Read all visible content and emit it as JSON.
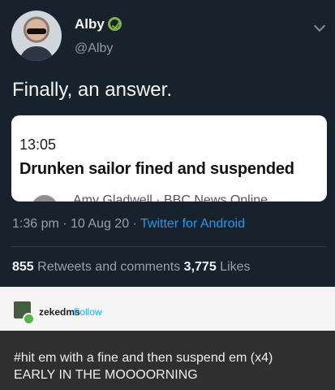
{
  "tweet": {
    "display_name": "Alby",
    "handle": "@Alby",
    "text": "Finally, an answer.",
    "card": {
      "time": "13:05",
      "headline": "Drunken sailor fined and suspended",
      "byline": "Amy Gladwell · BBC News Online"
    },
    "meta": {
      "timestamp": "1:36 pm · 10 Aug 20 · ",
      "app": "Twitter for Android"
    },
    "stats": {
      "retweets_count": "855",
      "retweets_label": " Retweets and comments ",
      "likes_count": "3,775",
      "likes_label": " Likes"
    }
  },
  "tumblr": {
    "username": "zekedms",
    "follow_label": "Follow",
    "post_line1": "#hit em with a fine and then suspend em (x4)",
    "post_line2": "EARLY IN THE MOOOORNING"
  },
  "colors": {
    "twitter_bg": "#17222d",
    "link_blue": "#1d9bf0",
    "tumblr_bg": "#2f2f30",
    "tumblr_follow": "#00b8ff"
  }
}
